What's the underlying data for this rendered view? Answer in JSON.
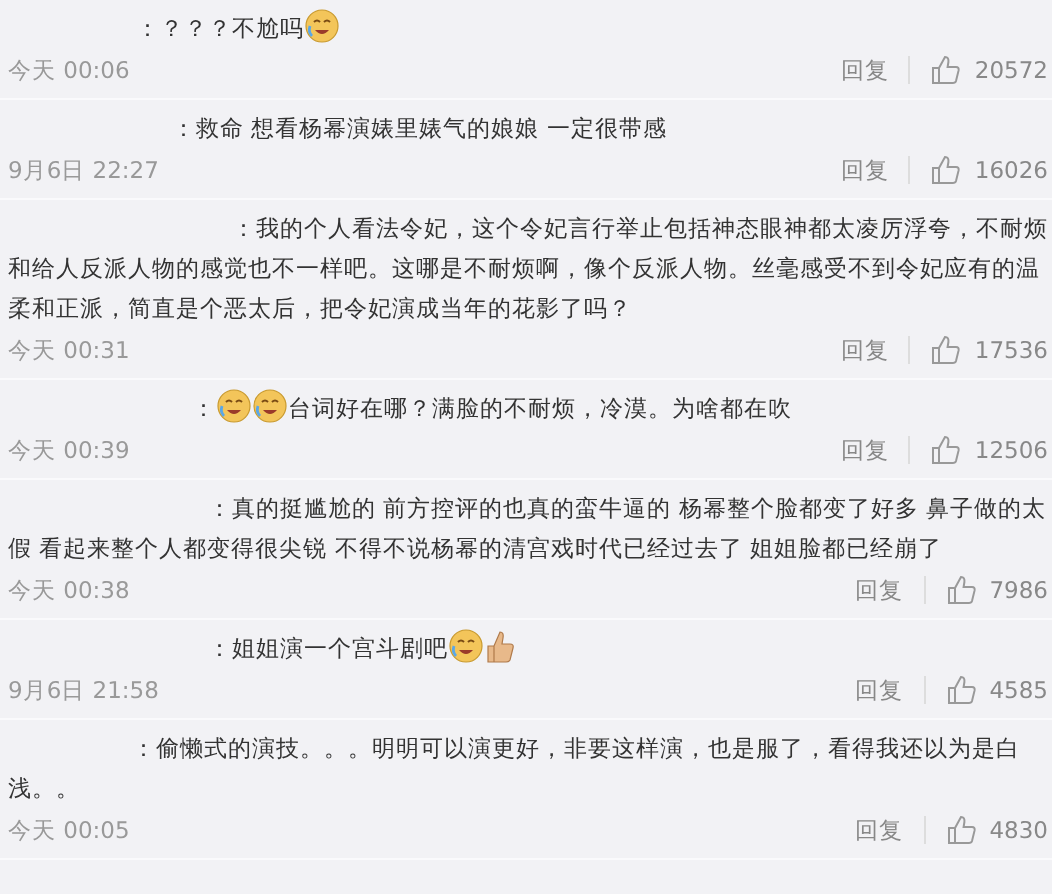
{
  "comments": [
    {
      "segments": [
        {
          "kind": "text",
          "text": "：？？？不尬吗"
        },
        {
          "kind": "face"
        }
      ],
      "time": "今天 00:06",
      "reply": "回复",
      "likes": "20572"
    },
    {
      "segments": [
        {
          "kind": "text",
          "text": "：救命 想看杨幂演婊里婊气的娘娘 一定很带感"
        }
      ],
      "time": "9月6日 22:27",
      "reply": "回复",
      "likes": "16026"
    },
    {
      "segments": [
        {
          "kind": "text",
          "text": "：我的个人看法令妃，这个令妃言行举止包括神态眼神都太凌厉浮夸，不耐烦和给人反派人物的感觉也不一样吧。这哪是不耐烦啊，像个反派人物。丝毫感受不到令妃应有的温柔和正派，简直是个恶太后，把令妃演成当年的花影了吗？"
        }
      ],
      "time": "今天 00:31",
      "reply": "回复",
      "likes": "17536"
    },
    {
      "segments": [
        {
          "kind": "text",
          "text": "："
        },
        {
          "kind": "face"
        },
        {
          "kind": "face"
        },
        {
          "kind": "text",
          "text": "台词好在哪？满脸的不耐烦，冷漠。为啥都在吹"
        }
      ],
      "time": "今天 00:39",
      "reply": "回复",
      "likes": "12506"
    },
    {
      "segments": [
        {
          "kind": "text",
          "text": "：真的挺尴尬的  前方控评的也真的蛮牛逼的  杨幂整个脸都变了好多  鼻子做的太假  看起来整个人都变得很尖锐  不得不说杨幂的清宫戏时代已经过去了  姐姐脸都已经崩了"
        }
      ],
      "time": "今天 00:38",
      "reply": "回复",
      "likes": "7986"
    },
    {
      "segments": [
        {
          "kind": "text",
          "text": "：姐姐演一个宫斗剧吧"
        },
        {
          "kind": "face"
        },
        {
          "kind": "thumb"
        }
      ],
      "time": "9月6日 21:58",
      "reply": "回复",
      "likes": "4585"
    },
    {
      "segments": [
        {
          "kind": "text",
          "text": "：偷懒式的演技。。。明明可以演更好，非要这样演，也是服了，看得我还以为是白浅。。"
        }
      ],
      "time": "今天 00:05",
      "reply": "回复",
      "likes": "4830"
    }
  ]
}
